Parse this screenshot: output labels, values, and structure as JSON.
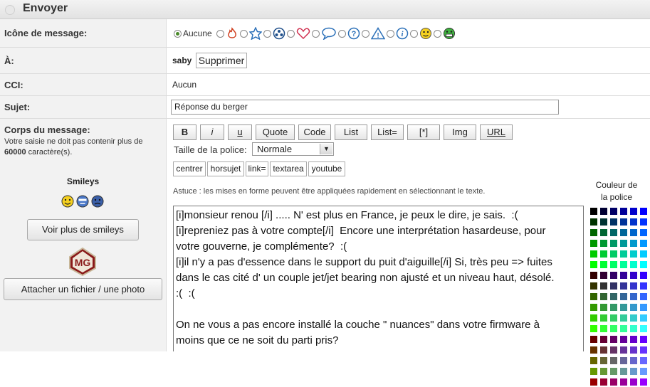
{
  "header": {
    "title": "Envoyer"
  },
  "icon_row": {
    "label": "Icône de message:",
    "none_label": "Aucune",
    "icons": [
      "fire-icon",
      "star-icon",
      "soccer-ball-icon",
      "heart-icon",
      "speech-bubble-icon",
      "question-icon",
      "warning-icon",
      "info-icon",
      "wink-icon",
      "grin-icon"
    ]
  },
  "to_row": {
    "label": "À:",
    "recipient": "saby",
    "remove_label": "Supprimer"
  },
  "cci_row": {
    "label": "CCI:",
    "value": "Aucun"
  },
  "subject_row": {
    "label": "Sujet:",
    "value": "Réponse du berger"
  },
  "body_row": {
    "label": "Corps du message:",
    "hint_before": "Votre saisie ne doit pas contenir plus de ",
    "hint_number": "60000",
    "hint_after": " caractère(s).",
    "smileys_title": "Smileys",
    "smileys": [
      "happy-smiley-icon",
      "cool-smiley-icon",
      "sad-smiley-icon"
    ],
    "more_smileys_label": "Voir plus de smileys",
    "logo_text": "MG",
    "attach_label": "Attacher un fichier / une photo"
  },
  "toolbar": {
    "buttons": [
      "B",
      "i",
      "u",
      "Quote",
      "Code",
      "List",
      "List=",
      "[*]",
      "Img",
      "URL"
    ],
    "font_size_label": "Taille de la police:",
    "font_size_value": "Normale",
    "buttons2": [
      "centrer",
      "horsujet",
      "link=",
      "textarea",
      "youtube"
    ],
    "tip": "Astuce : les mises en forme peuvent être appliquées rapidement en sélectionnant le texte."
  },
  "colors": {
    "title_line1": "Couleur de",
    "title_line2": "la police",
    "palette": [
      [
        "#000000",
        "#000033",
        "#000066",
        "#000099",
        "#0000cc",
        "#0000ff"
      ],
      [
        "#003300",
        "#003333",
        "#003366",
        "#003399",
        "#0033cc",
        "#0033ff"
      ],
      [
        "#006600",
        "#006633",
        "#006666",
        "#006699",
        "#0066cc",
        "#0066ff"
      ],
      [
        "#009900",
        "#009933",
        "#009966",
        "#009999",
        "#0099cc",
        "#0099ff"
      ],
      [
        "#00cc00",
        "#00cc33",
        "#00cc66",
        "#00cc99",
        "#00cccc",
        "#00ccff"
      ],
      [
        "#00ff00",
        "#00ff33",
        "#00ff66",
        "#00ff99",
        "#00ffcc",
        "#00ffff"
      ],
      [
        "#330000",
        "#330033",
        "#330066",
        "#330099",
        "#3300cc",
        "#3300ff"
      ],
      [
        "#333300",
        "#333333",
        "#333366",
        "#333399",
        "#3333cc",
        "#3333ff"
      ],
      [
        "#336600",
        "#336633",
        "#336666",
        "#336699",
        "#3366cc",
        "#3366ff"
      ],
      [
        "#339900",
        "#339933",
        "#339966",
        "#339999",
        "#3399cc",
        "#3399ff"
      ],
      [
        "#33cc00",
        "#33cc33",
        "#33cc66",
        "#33cc99",
        "#33cccc",
        "#33ccff"
      ],
      [
        "#33ff00",
        "#33ff33",
        "#33ff66",
        "#33ff99",
        "#33ffcc",
        "#33ffff"
      ],
      [
        "#660000",
        "#660033",
        "#660066",
        "#660099",
        "#6600cc",
        "#6600ff"
      ],
      [
        "#663300",
        "#663333",
        "#663366",
        "#663399",
        "#6633cc",
        "#6633ff"
      ],
      [
        "#666600",
        "#666633",
        "#666666",
        "#666699",
        "#6666cc",
        "#6666ff"
      ],
      [
        "#669900",
        "#669933",
        "#669966",
        "#669999",
        "#6699cc",
        "#6699ff"
      ],
      [
        "#990000",
        "#990033",
        "#990066",
        "#990099",
        "#9900cc",
        "#9900ff"
      ]
    ]
  },
  "message": {
    "lines": [
      "[i]monsieur renou [/i] ..... N' est plus en France, je peux le dire, je sais.  :(",
      "[i]repreniez pas à votre compte[/i]  Encore une interprétation hasardeuse, pour",
      "votre gouverne, je complémente?  :(",
      "[i]il n'y a pas d'essence dans le support du puit d'aiguille[/i] Si, très peu => fuites",
      "dans le cas cité d' un couple jet/jet bearing non ajusté et un niveau haut, désolé.",
      ":(  :(",
      "",
      "On ne vous a pas encore installé la couche \" nuances\" dans votre firmware à",
      "moins que ce ne soit du parti pris?"
    ]
  }
}
